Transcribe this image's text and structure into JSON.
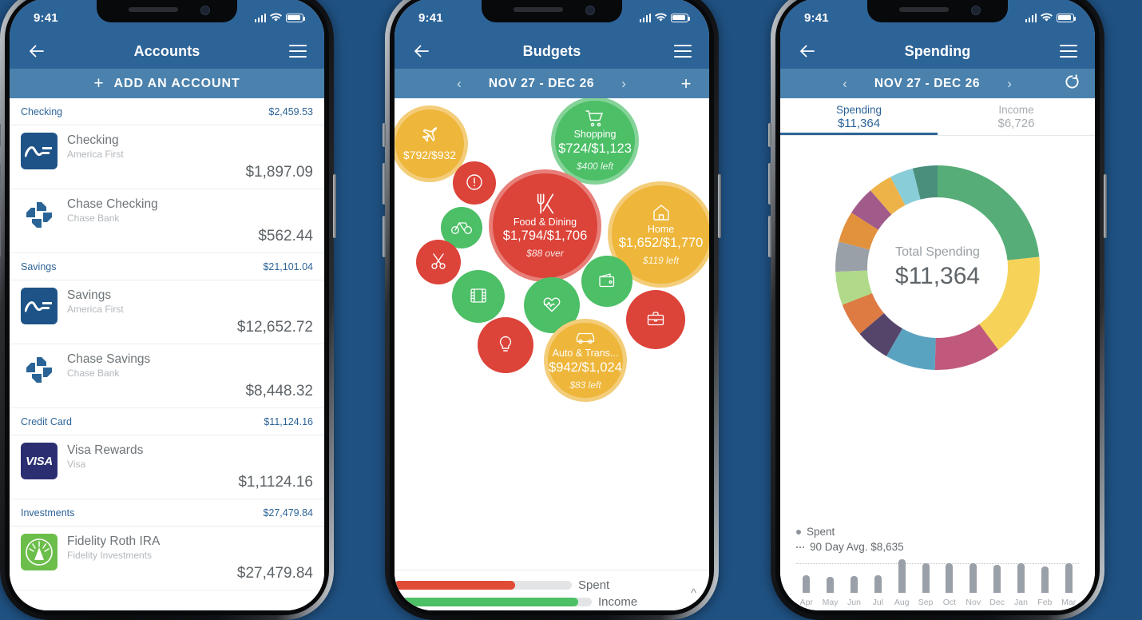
{
  "status": {
    "time": "9:41"
  },
  "phones": {
    "accounts": {
      "nav_title": "Accounts",
      "add_account_label": "ADD AN ACCOUNT",
      "add_icon": "plus-icon",
      "back_icon": "back-arrow-icon",
      "menu_icon": "hamburger-menu-icon",
      "groups": [
        {
          "label": "Checking",
          "total": "$2,459.53",
          "rows": [
            {
              "name": "Checking",
              "institution": "America First",
              "balance": "$1,897.09",
              "logo": "america-first-logo"
            },
            {
              "name": "Chase Checking",
              "institution": "Chase Bank",
              "balance": "$562.44",
              "logo": "chase-logo"
            }
          ]
        },
        {
          "label": "Savings",
          "total": "$21,101.04",
          "rows": [
            {
              "name": "Savings",
              "institution": "America First",
              "balance": "$12,652.72",
              "logo": "america-first-logo"
            },
            {
              "name": "Chase Savings",
              "institution": "Chase Bank",
              "balance": "$8,448.32",
              "logo": "chase-logo"
            }
          ]
        },
        {
          "label": "Credit Card",
          "total": "$11,124.16",
          "rows": [
            {
              "name": "Visa Rewards",
              "institution": "Visa",
              "balance": "$1,1124.16",
              "logo": "visa-logo"
            }
          ]
        },
        {
          "label": "Investments",
          "total": "$27,479.84",
          "rows": [
            {
              "name": "Fidelity Roth IRA",
              "institution": "Fidelity Investments",
              "balance": "$27,479.84",
              "logo": "fidelity-logo"
            }
          ]
        }
      ]
    },
    "budgets": {
      "nav_title": "Budgets",
      "date_range": "NOV 27 - DEC 26",
      "prev_icon": "chevron-left-icon",
      "next_icon": "chevron-right-icon",
      "add_icon": "plus-icon",
      "bubbles": [
        {
          "icon": "airplane-icon",
          "name": "",
          "amount": "$792/$932",
          "note": "",
          "color": "yellow"
        },
        {
          "icon": "shopping-cart-icon",
          "name": "Shopping",
          "amount": "$724/$1,123",
          "note": "$400 left",
          "color": "green"
        },
        {
          "icon": "alert-icon",
          "name": "",
          "amount": "",
          "note": "",
          "color": "red"
        },
        {
          "icon": "bicycle-icon",
          "name": "",
          "amount": "",
          "note": "",
          "color": "green"
        },
        {
          "icon": "scissors-icon",
          "name": "",
          "amount": "",
          "note": "",
          "color": "red"
        },
        {
          "icon": "utensils-icon",
          "name": "Food & Dining",
          "amount": "$1,794/$1,706",
          "note": "$88 over",
          "color": "red"
        },
        {
          "icon": "home-icon",
          "name": "Home",
          "amount": "$1,652/$1,770",
          "note": "$119 left",
          "color": "yellow"
        },
        {
          "icon": "film-icon",
          "name": "",
          "amount": "",
          "note": "",
          "color": "green"
        },
        {
          "icon": "heartbeat-icon",
          "name": "",
          "amount": "",
          "note": "",
          "color": "green"
        },
        {
          "icon": "wallet-icon",
          "name": "",
          "amount": "",
          "note": "",
          "color": "green"
        },
        {
          "icon": "lightbulb-icon",
          "name": "",
          "amount": "",
          "note": "",
          "color": "red"
        },
        {
          "icon": "briefcase-icon",
          "name": "",
          "amount": "",
          "note": "",
          "color": "red"
        },
        {
          "icon": "car-icon",
          "name": "Auto & Trans...",
          "amount": "$942/$1,024",
          "note": "$83 left",
          "color": "yellow"
        }
      ],
      "legend": [
        {
          "label": "Spent",
          "color": "#e04b36",
          "percent": 68
        },
        {
          "label": "Income",
          "color": "#4cbf67",
          "percent": 96
        }
      ],
      "collapse_icon": "chevron-up-icon"
    },
    "spending": {
      "nav_title": "Spending",
      "date_range": "NOV 27 - DEC 26",
      "refresh_icon": "refresh-icon",
      "tabs": [
        {
          "label": "Spending",
          "value": "$11,364",
          "active": true
        },
        {
          "label": "Income",
          "value": "$6,726",
          "active": false
        }
      ],
      "donut_center_label": "Total Spending",
      "donut_center_value": "$11,364",
      "legend_spent": "Spent",
      "legend_avg": "90 Day Avg. $8,635"
    }
  },
  "chart_data": [
    {
      "type": "pie",
      "title": "Total Spending",
      "total": 11364,
      "center_value": "$11,364",
      "legend": "none",
      "slices": [
        {
          "label": "slice-1",
          "value": 2650,
          "color": "#56ad77"
        },
        {
          "label": "slice-2",
          "value": 1880,
          "color": "#f6d358"
        },
        {
          "label": "slice-3",
          "value": 1200,
          "color": "#c0597c"
        },
        {
          "label": "slice-4",
          "value": 900,
          "color": "#5aa3c0"
        },
        {
          "label": "slice-5",
          "value": 620,
          "color": "#55456b"
        },
        {
          "label": "slice-6",
          "value": 600,
          "color": "#dd7b43"
        },
        {
          "label": "slice-7",
          "value": 600,
          "color": "#b0da8a"
        },
        {
          "label": "slice-8",
          "value": 540,
          "color": "#9aa0a8"
        },
        {
          "label": "slice-9",
          "value": 560,
          "color": "#e2913d"
        },
        {
          "label": "slice-10",
          "value": 520,
          "color": "#a05b8b"
        },
        {
          "label": "slice-11",
          "value": 430,
          "color": "#edb349"
        },
        {
          "label": "slice-12",
          "value": 420,
          "color": "#89cdd8"
        },
        {
          "label": "slice-13",
          "value": 444,
          "color": "#4a8f7c"
        }
      ]
    },
    {
      "type": "bar",
      "title": "Spent",
      "categories": [
        "Apr",
        "May",
        "Jun",
        "Jul",
        "Aug",
        "Sep",
        "Oct",
        "Nov",
        "Dec",
        "Jan",
        "Feb",
        "Mar"
      ],
      "values": [
        5200,
        4900,
        5000,
        5400,
        10100,
        8900,
        8900,
        8900,
        8300,
        8800,
        7900,
        8800
      ],
      "avg_line": 8635,
      "avg_label": "90 Day Avg. $8,635",
      "ylabel": "",
      "xlabel": "",
      "grid": false,
      "legend": "top-left"
    }
  ],
  "colors": {
    "header_blue": "#2d6498",
    "subbar_blue": "#4b82ad",
    "page_bg": "#1f5182",
    "red": "#dc4339",
    "green": "#4cbf67",
    "yellow": "#eeb63a"
  }
}
